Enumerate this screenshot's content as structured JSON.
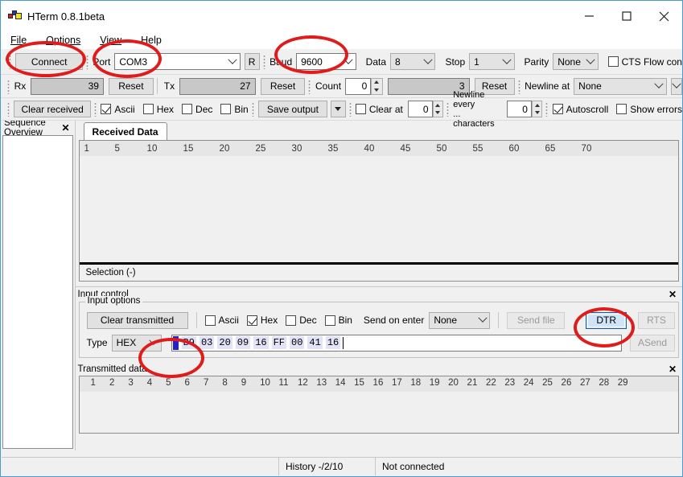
{
  "window": {
    "title": "HTerm 0.8.1beta",
    "icon": "hterm-mondrian-icon",
    "minimize": "minimize-icon",
    "maximize": "maximize-icon",
    "close": "close-icon"
  },
  "menu": [
    {
      "label": "File"
    },
    {
      "label": "Options"
    },
    {
      "label": "View"
    },
    {
      "label": "Help"
    }
  ],
  "connection_bar": {
    "connect_button": "Connect",
    "port_label": "Port",
    "port_value": "COM3",
    "refresh_button": "R",
    "baud_label": "Baud",
    "baud_value": "9600",
    "data_label": "Data",
    "data_value": "8",
    "stop_label": "Stop",
    "stop_value": "1",
    "parity_label": "Parity",
    "parity_value": "None",
    "cts_label": "CTS Flow con"
  },
  "counter_bar": {
    "rx_label": "Rx",
    "rx_value": "39",
    "rx_reset": "Reset",
    "tx_label": "Tx",
    "tx_value": "27",
    "tx_reset": "Reset",
    "count_label": "Count",
    "count_value": "0",
    "count_total": "3",
    "count_reset": "Reset",
    "newline_at_label": "Newline at",
    "newline_at_value": "None"
  },
  "receive_bar": {
    "clear_received": "Clear received",
    "ascii_label": "Ascii",
    "hex_label": "Hex",
    "dec_label": "Dec",
    "bin_label": "Bin",
    "save_output": "Save output",
    "save_dropdown": "chevron-down-icon",
    "clear_at_label": "Clear at",
    "clear_at_value": "0",
    "newline_every_label": "Newline every",
    "newline_every_label2": "... characters",
    "newline_every_value": "0",
    "autoscroll_label": "Autoscroll",
    "show_errors_label": "Show errors"
  },
  "sidebar": {
    "title": "Sequence Overview",
    "close": "close-icon"
  },
  "received": {
    "tab_label": "Received Data",
    "ruler": [
      "1",
      "5",
      "10",
      "15",
      "20",
      "25",
      "30",
      "35",
      "40",
      "45",
      "50",
      "55",
      "60",
      "65",
      "70"
    ],
    "selection": "Selection (-)"
  },
  "input_control": {
    "title": "Input control",
    "close": "close-icon",
    "group_title": "Input options",
    "clear_transmitted": "Clear transmitted",
    "ascii_label": "Ascii",
    "hex_label": "Hex",
    "dec_label": "Dec",
    "bin_label": "Bin",
    "send_on_enter_label": "Send on enter",
    "send_on_enter_value": "None",
    "send_file": "Send file",
    "dtr_button": "DTR",
    "rts_button": "RTS",
    "type_label": "Type",
    "type_value": "HEX",
    "hex_bytes": [
      "B9",
      "03",
      "20",
      "09",
      "16",
      "FF",
      "00",
      "41",
      "16"
    ],
    "asend_button": "ASend"
  },
  "transmitted": {
    "title": "Transmitted data",
    "close": "close-icon",
    "ruler": [
      "1",
      "2",
      "3",
      "4",
      "5",
      "6",
      "7",
      "8",
      "9",
      "10",
      "11",
      "12",
      "13",
      "14",
      "15",
      "16",
      "17",
      "18",
      "19",
      "20",
      "21",
      "22",
      "23",
      "24",
      "25",
      "26",
      "27",
      "28",
      "29"
    ]
  },
  "status_bar": {
    "history": "History -/2/10",
    "connection": "Not connected"
  },
  "annotations": {
    "accent_color": "#e01b1b",
    "targets": [
      "connect-button",
      "port-field",
      "baud-field",
      "dtr-button",
      "type-combo"
    ]
  }
}
